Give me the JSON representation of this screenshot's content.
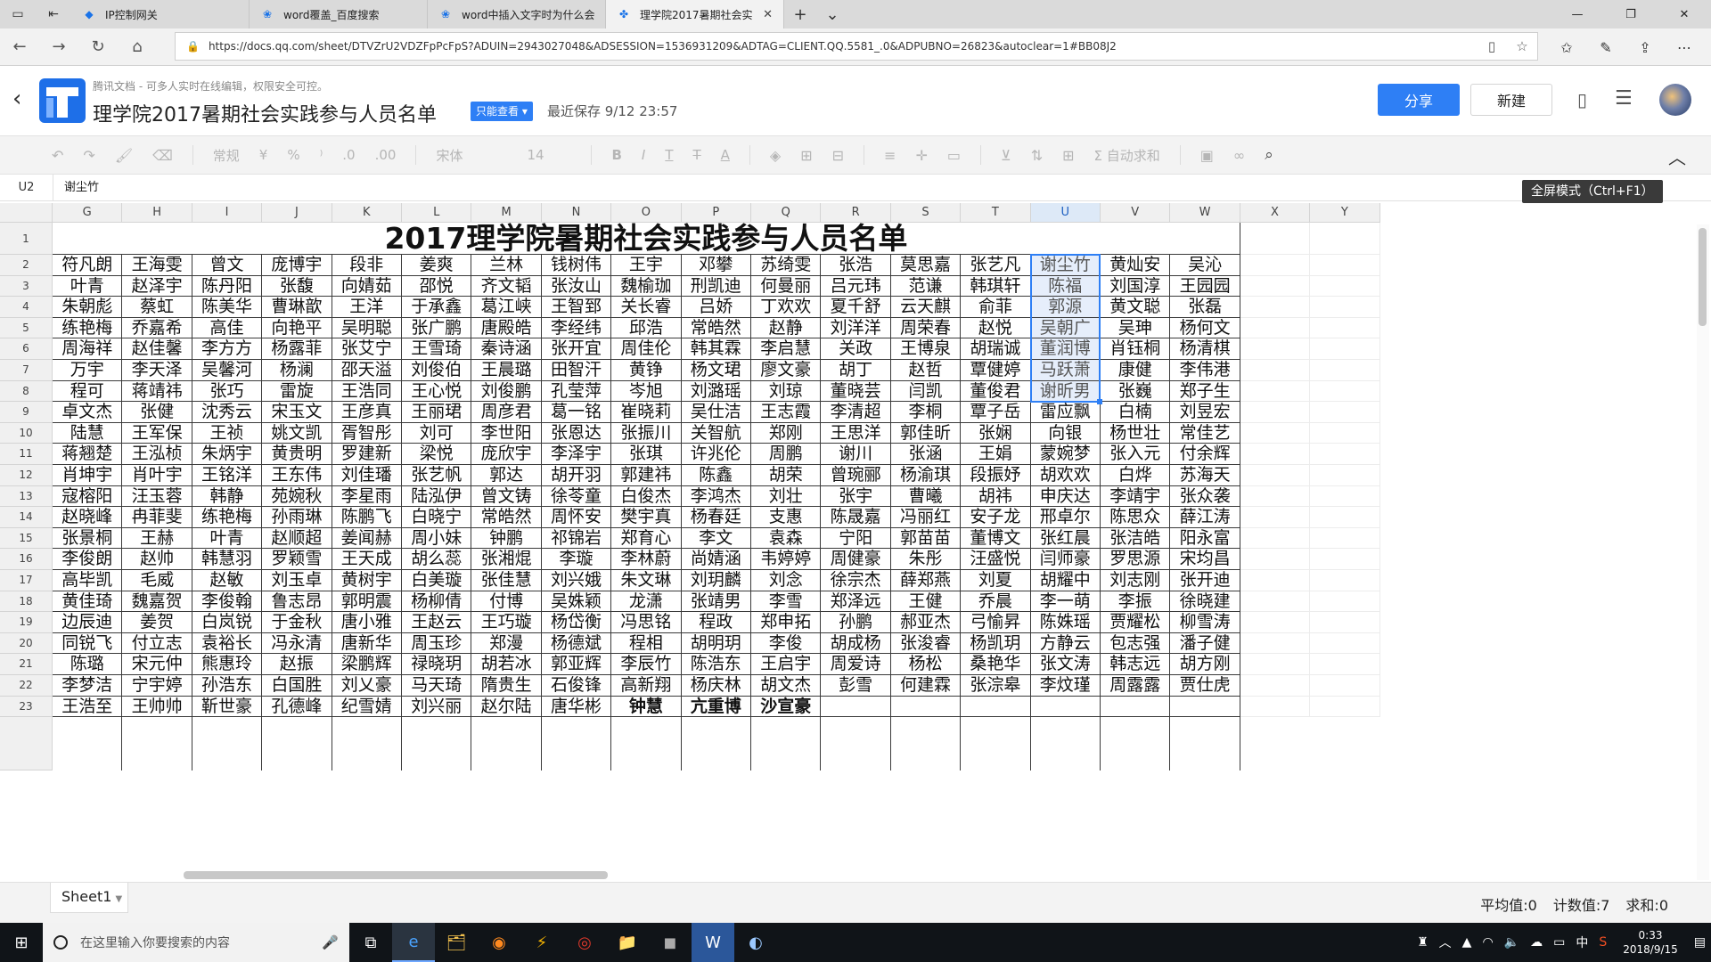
{
  "browser": {
    "tabs": [
      {
        "label": "IP控制网关",
        "icon": "shield-icon"
      },
      {
        "label": "word覆盖_百度搜索",
        "icon": "paw-icon"
      },
      {
        "label": "word中插入文字时为什么会",
        "icon": "paw-icon"
      },
      {
        "label": "理学院2017暑期社会实",
        "icon": "tencent-docs-icon",
        "active": true
      }
    ],
    "url": "https://docs.qq.com/sheet/DTVZrU2VDZFpPcFpS?ADUIN=2943027048&ADSESSION=1536931209&ADTAG=CLIENT.QQ.5581_.0&ADPUBNO=26823&autoclear=1#BB08J2"
  },
  "doc": {
    "tagline": "腾讯文档 - 可多人实时在线编辑，权限安全可控。",
    "title": "理学院2017暑期社会实践参与人员名单",
    "permission": "只能查看 ▾",
    "save_status": "最近保存 9/12 23:57",
    "share_label": "分享",
    "new_label": "新建"
  },
  "toolbar": {
    "format": "常规",
    "currency": "¥",
    "percent": "%",
    "comma": "⁾",
    "dec1": ".0",
    "dec2": ".00",
    "font": "宋体",
    "font_size": "14",
    "bold": "B",
    "italic": "I",
    "underline": "T",
    "strike": "T",
    "color": "A",
    "autosum": "Σ 自动求和",
    "tooltip": "全屏模式（Ctrl+F1）"
  },
  "formula_bar": {
    "cell_ref": "U2",
    "content": "谢尘竹"
  },
  "sheet": {
    "columns": [
      "G",
      "H",
      "I",
      "J",
      "K",
      "L",
      "M",
      "N",
      "O",
      "P",
      "Q",
      "R",
      "S",
      "T",
      "U",
      "V",
      "W",
      "X",
      "Y"
    ],
    "selected_column": "U",
    "title": "2017理学院暑期社会实践参与人员名单",
    "rows": [
      [
        "符凡朗",
        "王海雯",
        "曾文",
        "庞博宇",
        "段非",
        "姜爽",
        "兰林",
        "钱树伟",
        "王宇",
        "邓攀",
        "苏绮雯",
        "张浩",
        "莫思嘉",
        "张艺凡",
        "谢尘竹",
        "黄灿安",
        "吴沁"
      ],
      [
        "叶青",
        "赵泽宇",
        "陈丹阳",
        "张馥",
        "向婧茹",
        "邵悦",
        "齐文韬",
        "张汝山",
        "魏榆珈",
        "刑凯迪",
        "何曼丽",
        "吕元玮",
        "范谦",
        "韩琪轩",
        "陈福",
        "刘国淳",
        "王园园"
      ],
      [
        "朱朝彪",
        "蔡虹",
        "陈美华",
        "曹琳歆",
        "王洋",
        "于承鑫",
        "葛江峡",
        "王智郅",
        "关长睿",
        "吕娇",
        "丁欢欢",
        "夏千舒",
        "云天麒",
        "俞菲",
        "郭源",
        "黄文聪",
        "张磊"
      ],
      [
        "练艳梅",
        "乔嘉希",
        "高佳",
        "向艳平",
        "吴明聪",
        "张广鹏",
        "唐殿皓",
        "李经纬",
        "邱浩",
        "常皓然",
        "赵静",
        "刘洋洋",
        "周荣春",
        "赵悦",
        "吴朝广",
        "吴珅",
        "杨何文"
      ],
      [
        "周海祥",
        "赵佳馨",
        "李方方",
        "杨露菲",
        "张艾宁",
        "王雪琦",
        "秦诗涵",
        "张开宜",
        "周佳伦",
        "韩其霖",
        "李启慧",
        "关政",
        "王博泉",
        "胡瑞诚",
        "董润博",
        "肖钰桐",
        "杨清棋"
      ],
      [
        "万宇",
        "李天泽",
        "吴馨河",
        "杨澜",
        "邵天溢",
        "刘俊伯",
        "王晨璐",
        "田智汗",
        "黄铮",
        "杨文珺",
        "廖文豪",
        "胡丁",
        "赵哲",
        "覃健婷",
        "马跃萧",
        "康健",
        "李伟港"
      ],
      [
        "程可",
        "蒋靖祎",
        "张巧",
        "雷旋",
        "王浩同",
        "王心悦",
        "刘俊鹏",
        "孔莹萍",
        "岑旭",
        "刘潞瑶",
        "刘琼",
        "董晓芸",
        "闫凯",
        "董俊君",
        "谢昕男",
        "张巍",
        "郑子生"
      ],
      [
        "卓文杰",
        "张健",
        "沈秀云",
        "宋玉文",
        "王彦真",
        "王丽珺",
        "周彦君",
        "葛一铭",
        "崔晓莉",
        "吴仕洁",
        "王志霞",
        "李清超",
        "李桐",
        "覃子岳",
        "雷应飘",
        "白楠",
        "刘昱宏"
      ],
      [
        "陆慧",
        "王军保",
        "王祯",
        "姚文凯",
        "胥智彤",
        "刘可",
        "李世阳",
        "张恩达",
        "张振川",
        "关智航",
        "郑刚",
        "王思洋",
        "郭佳昕",
        "张娴",
        "向银",
        "杨世壮",
        "常佳艺"
      ],
      [
        "蒋翘楚",
        "王泓桢",
        "朱炳宇",
        "黄贵明",
        "罗建新",
        "梁悦",
        "庞欣宇",
        "李泽宇",
        "张琪",
        "许兆伦",
        "周鹏",
        "谢川",
        "张涵",
        "王娟",
        "蒙婉梦",
        "张入元",
        "付余辉"
      ],
      [
        "肖坤宇",
        "肖叶宇",
        "王铭洋",
        "王东伟",
        "刘佳璠",
        "张艺帆",
        "郭达",
        "胡开羽",
        "郭建祎",
        "陈鑫",
        "胡荣",
        "曾琬郦",
        "杨渝琪",
        "段振妤",
        "胡欢欢",
        "白烨",
        "苏海天"
      ],
      [
        "寇榕阳",
        "汪玉蓉",
        "韩静",
        "苑婉秋",
        "李星雨",
        "陆泓伊",
        "曾文铸",
        "徐苓童",
        "白俊杰",
        "李鸿杰",
        "刘壮",
        "张宇",
        "曹曦",
        "胡祎",
        "申庆达",
        "李靖宇",
        "张众袭"
      ],
      [
        "赵晓峰",
        "冉菲斐",
        "练艳梅",
        "孙雨琳",
        "陈鹏飞",
        "白晓宁",
        "常皓然",
        "周怀安",
        "樊宇真",
        "杨春廷",
        "支惠",
        "陈晟嘉",
        "冯丽红",
        "安子龙",
        "邢卓尔",
        "陈思众",
        "薛江涛"
      ],
      [
        "张景桐",
        "王赫",
        "叶青",
        "赵顺超",
        "姜闻赫",
        "周小妹",
        "钟鹏",
        "祁锦岩",
        "郑育心",
        "李文",
        "袁森",
        "宁阳",
        "郭苗苗",
        "董博文",
        "张红晨",
        "张洁皓",
        "阳永富"
      ],
      [
        "李俊朗",
        "赵帅",
        "韩慧羽",
        "罗颖雪",
        "王天成",
        "胡么蕊",
        "张湘焜",
        "李璇",
        "李林蔚",
        "尚婧涵",
        "韦婷婷",
        "周健豪",
        "朱彤",
        "汪盛悦",
        "闫师豪",
        "罗思源",
        "宋均昌"
      ],
      [
        "高毕凯",
        "毛威",
        "赵敏",
        "刘玉卓",
        "黄树宇",
        "白美璇",
        "张佳慧",
        "刘兴娥",
        "朱文琳",
        "刘玥麟",
        "刘念",
        "徐宗杰",
        "薛郑燕",
        "刘夏",
        "胡耀中",
        "刘志刚",
        "张开迪"
      ],
      [
        "黄佳琦",
        "魏嘉贺",
        "李俊翰",
        "鲁志昂",
        "郭明震",
        "杨柳倩",
        "付博",
        "吴姝颖",
        "龙潇",
        "张靖男",
        "李雪",
        "郑泽远",
        "王健",
        "乔晨",
        "李一萌",
        "李振",
        "徐晓建"
      ],
      [
        "边辰迪",
        "姜贺",
        "白岚锐",
        "于金秋",
        "唐小雅",
        "王赵云",
        "王巧璇",
        "杨岱衡",
        "冯思铭",
        "程政",
        "郑申拓",
        "孙鹏",
        "郝亚杰",
        "弓愉昇",
        "陈姝瑶",
        "贾耀松",
        "柳雪涛"
      ],
      [
        "同锐飞",
        "付立志",
        "袁裕长",
        "冯永清",
        "唐新华",
        "周玉珍",
        "郑漫",
        "杨德斌",
        "程相",
        "胡明玥",
        "李俊",
        "胡成杨",
        "张浚睿",
        "杨凯玥",
        "方静云",
        "包志强",
        "潘子健"
      ],
      [
        "陈璐",
        "宋元仲",
        "熊惠玲",
        "赵振",
        "梁鹏辉",
        "禄晓玥",
        "胡若冰",
        "郭亚辉",
        "李辰竹",
        "陈浩东",
        "王启宇",
        "周爱诗",
        "杨松",
        "桑艳华",
        "张文涛",
        "韩志远",
        "胡方刚"
      ],
      [
        "李梦洁",
        "宁宇婷",
        "孙浩东",
        "白国胜",
        "刘乂豪",
        "马天琦",
        "隋贵生",
        "石俊锋",
        "高新翔",
        "杨庆林",
        "胡文杰",
        "彭雪",
        "何建霖",
        "张淙皋",
        "李炆瑾",
        "周露露",
        "贾仕虎"
      ],
      [
        "王浩至",
        "王帅帅",
        "靳世豪",
        "孔德峰",
        "纪雪婧",
        "刘兴丽",
        "赵尔陆",
        "唐华彬",
        "钟慧",
        "亢重博",
        "沙宣豪",
        "",
        "",
        "",
        "",
        "",
        ""
      ]
    ]
  },
  "footer": {
    "sheet_tab": "Sheet1",
    "avg": "平均值:0",
    "count": "计数值:7",
    "sum": "求和:0"
  },
  "taskbar": {
    "search_placeholder": "在这里输入你要搜索的内容",
    "time": "0:33",
    "date": "2018/9/15",
    "ime": "中"
  }
}
